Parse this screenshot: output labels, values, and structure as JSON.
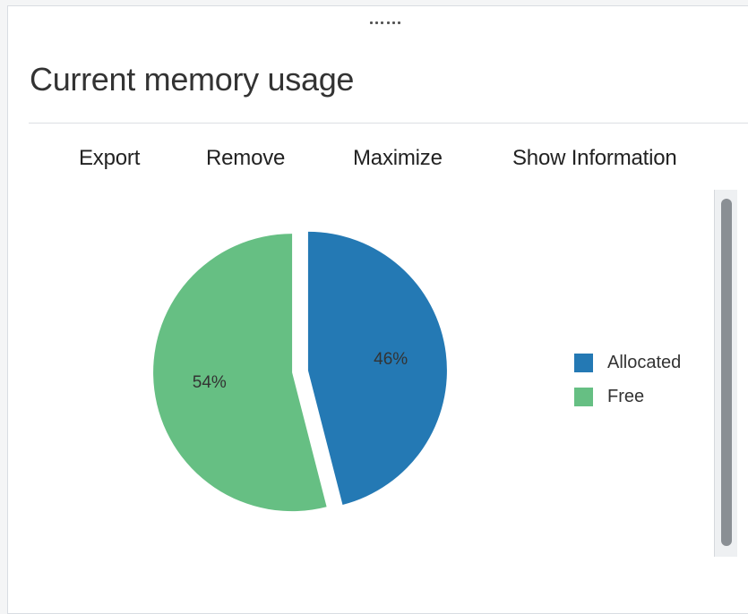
{
  "panel": {
    "title": "Current memory usage"
  },
  "toolbar": {
    "export_label": "Export",
    "remove_label": "Remove",
    "maximize_label": "Maximize",
    "show_info_label": "Show Information"
  },
  "colors": {
    "allocated": "#2479b4",
    "free": "#66bf83"
  },
  "chart_data": {
    "type": "pie",
    "title": "",
    "categories": [
      "Allocated",
      "Free"
    ],
    "values": [
      46,
      54
    ],
    "data_labels": [
      "46%",
      "54%"
    ],
    "colors": [
      "#2479b4",
      "#66bf83"
    ],
    "exploded": true,
    "legend": "right"
  },
  "legend": {
    "items": [
      {
        "label": "Allocated"
      },
      {
        "label": "Free"
      }
    ]
  }
}
